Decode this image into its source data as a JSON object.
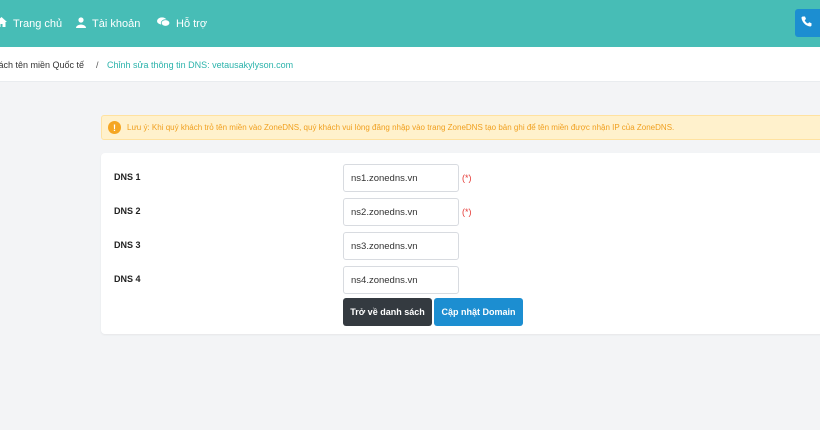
{
  "nav": {
    "home": "Trang chủ",
    "account": "Tài khoản",
    "support": "Hỗ trợ"
  },
  "breadcrumb": {
    "list": "sách tên miền Quốc tế",
    "separator": "/",
    "current": "Chỉnh sửa thông tin DNS: vetausakylyson.com"
  },
  "alert": {
    "icon": "!",
    "text": "Lưu ý: Khi quý khách trỏ tên miền vào ZoneDNS, quý khách vui lòng đăng nhập vào trang ZoneDNS tạo bản ghi để tên miền được nhận IP của ZoneDNS."
  },
  "dns": [
    {
      "label": "DNS 1",
      "value": "ns1.zonedns.vn",
      "required": "(*)"
    },
    {
      "label": "DNS 2",
      "value": "ns2.zonedns.vn",
      "required": "(*)"
    },
    {
      "label": "DNS 3",
      "value": "ns3.zonedns.vn"
    },
    {
      "label": "DNS 4",
      "value": "ns4.zonedns.vn"
    }
  ],
  "buttons": {
    "back": "Trở về danh sách",
    "update": "Cập nhật Domain"
  },
  "colors": {
    "header": "#47bdb6",
    "primary": "#1c8ed1",
    "dark": "#343a40",
    "warning_text": "#f0a020",
    "required": "#e53935"
  }
}
